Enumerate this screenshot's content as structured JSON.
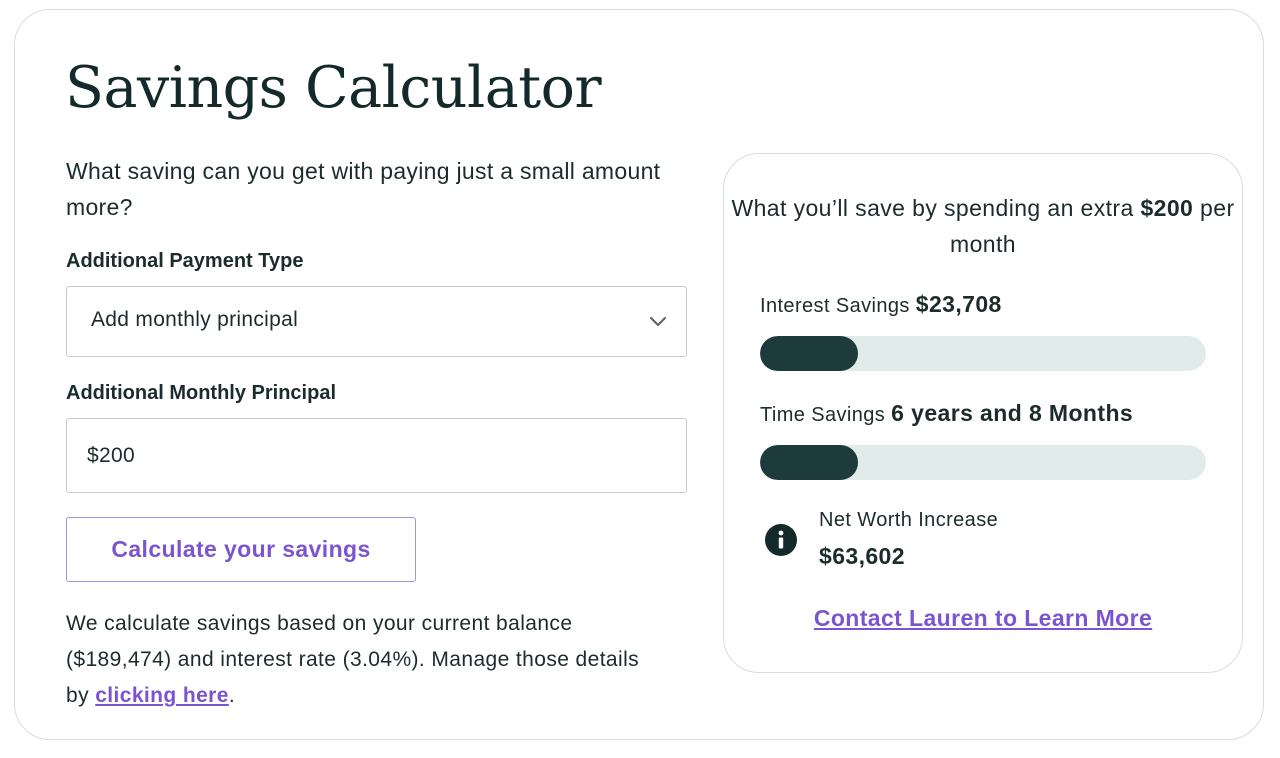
{
  "title": "Savings Calculator",
  "intro": "What saving can you get with paying just a small amount more?",
  "payment_type": {
    "label": "Additional Payment Type",
    "selected": "Add monthly principal",
    "icon": "chevron-down-icon"
  },
  "principal": {
    "label": "Additional Monthly Principal",
    "value": "$200"
  },
  "calculate_button": "Calculate your savings",
  "footnote": {
    "text": "We calculate savings based on your current balance ($189,474) and interest rate (3.04%). Manage those details by ",
    "link": "clicking here",
    "end": "."
  },
  "results": {
    "heading_prefix": "What you’ll save by spending an extra ",
    "heading_amount": "$200",
    "heading_suffix": " per month",
    "interest": {
      "label": "Interest Savings ",
      "value": "$23,708",
      "progress": 0.22
    },
    "time": {
      "label": "Time Savings ",
      "value": "6 years and 8 Months",
      "progress": 0.22
    },
    "net_worth": {
      "icon": "info-icon",
      "label": "Net Worth Increase",
      "value": "$63,602"
    },
    "contact_link": "Contact Lauren to Learn More"
  },
  "colors": {
    "accent": "#7b55d0",
    "bar_fill": "#1d3a3d",
    "bar_track": "#e1ecea",
    "text": "#1c2b2b"
  }
}
